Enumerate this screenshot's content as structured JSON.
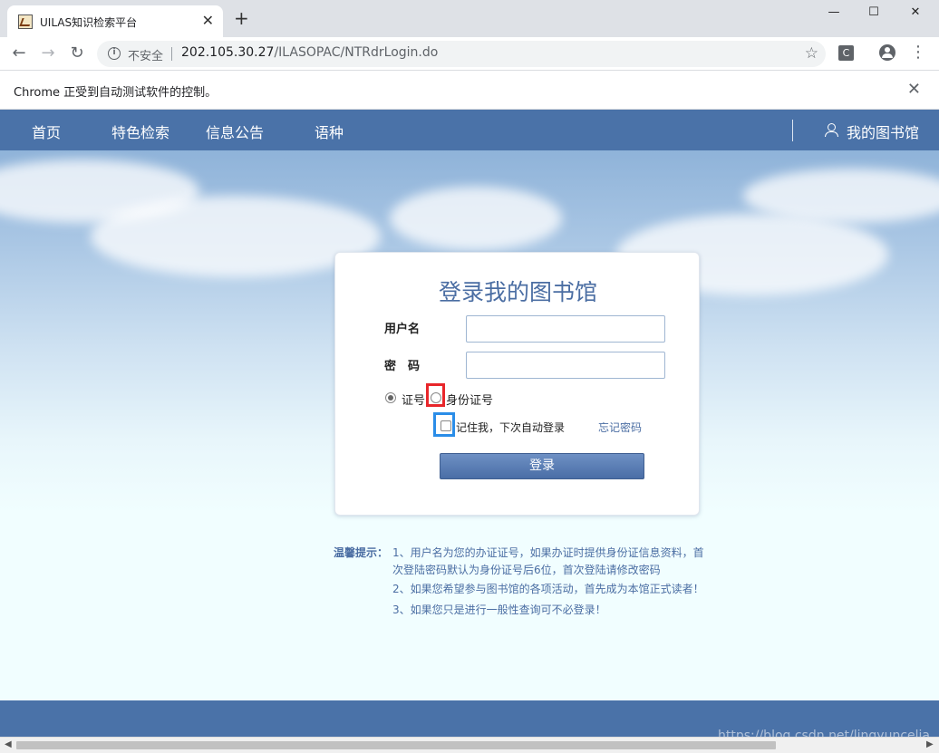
{
  "browser": {
    "tab_title": "UILAS知识检索平台",
    "tab_close": "✕",
    "new_tab": "+",
    "window_minimize": "—",
    "window_maximize": "☐",
    "window_close": "✕",
    "back": "←",
    "forward": "→",
    "reload": "↻",
    "security_label": "不安全",
    "url_host": "202.105.30.27",
    "url_path": "/ILASOPAC/NTRdrLogin.do",
    "bookmark_star": "☆",
    "extension_letter": "C",
    "menu": "⋮",
    "infobar_text": "Chrome 正受到自动测试软件的控制。",
    "infobar_close": "✕"
  },
  "nav": {
    "items": [
      "首页",
      "特色检索",
      "信息公告",
      "语种"
    ],
    "my_library": "我的图书馆"
  },
  "login": {
    "title": "登录我的图书馆",
    "username_label": "用户名",
    "password_label": "密　码",
    "radio_card": "证号",
    "radio_id": "身份证号",
    "remember": "记住我，下次自动登录",
    "forgot": "忘记密码",
    "submit": "登录"
  },
  "tips": {
    "label": "温馨提示：",
    "lines": [
      "1、用户名为您的办证证号，如果办证时提供身份证信息资料，首次登陆密码默认为身份证号后6位，首次登陆请修改密码",
      "2、如果您希望参与图书馆的各项活动，首先成为本馆正式读者！",
      "3、如果您只是进行一般性查询可不必登录！"
    ]
  },
  "watermark": "https://blog.csdn.net/lingyuncelia",
  "colors": {
    "nav_bg": "#4a72a8",
    "accent_text": "#4b6ea3",
    "highlight_red": "#e8262a",
    "highlight_blue": "#2a8de8"
  }
}
